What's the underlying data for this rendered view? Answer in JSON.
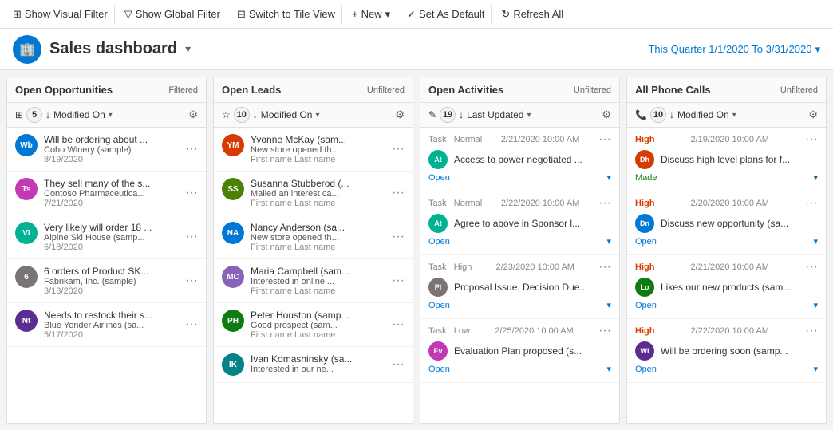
{
  "toolbar": {
    "show_visual_filter": "Show Visual Filter",
    "show_global_filter": "Show Global Filter",
    "switch_tile_view": "Switch to Tile View",
    "new_label": "New",
    "set_as_default": "Set As Default",
    "refresh_all": "Refresh All"
  },
  "header": {
    "title": "Sales dashboard",
    "date_range": "This Quarter 1/1/2020 To 3/31/2020"
  },
  "columns": [
    {
      "id": "open-opportunities",
      "title": "Open Opportunities",
      "status": "Filtered",
      "count": 5,
      "sort_by": "Modified On",
      "items": [
        {
          "initials": "Wb",
          "color": "#0078d4",
          "title": "Will be ordering about ...",
          "company": "Coho Winery (sample)",
          "date": "8/19/2020"
        },
        {
          "initials": "Ts",
          "color": "#c239b3",
          "title": "They sell many of the s...",
          "company": "Contoso Pharmaceutica...",
          "date": "7/21/2020"
        },
        {
          "initials": "VI",
          "color": "#00b294",
          "title": "Very likely will order 18 ...",
          "company": "Alpine Ski House (samp...",
          "date": "6/18/2020"
        },
        {
          "initials": "6",
          "color": "#7a7574",
          "title": "6 orders of Product SK...",
          "company": "Fabrikam, Inc. (sample)",
          "date": "3/18/2020"
        },
        {
          "initials": "Nt",
          "color": "#5c2d91",
          "title": "Needs to restock their s...",
          "company": "Blue Yonder Airlines (sa...",
          "date": "5/17/2020"
        }
      ]
    },
    {
      "id": "open-leads",
      "title": "Open Leads",
      "status": "Unfiltered",
      "count": 10,
      "sort_by": "Modified On",
      "items": [
        {
          "initials": "YM",
          "color": "#d83b01",
          "name": "Yvonne McKay (sam...",
          "note": "New store opened th...",
          "sub": "First name Last name"
        },
        {
          "initials": "SS",
          "color": "#498205",
          "name": "Susanna Stubberod (...",
          "note": "Mailed an interest ca...",
          "sub": "First name Last name"
        },
        {
          "initials": "NA",
          "color": "#0078d4",
          "name": "Nancy Anderson (sa...",
          "note": "New store opened th...",
          "sub": "First name Last name"
        },
        {
          "initials": "MC",
          "color": "#8764b8",
          "name": "Maria Campbell (sam...",
          "note": "Interested in online ...",
          "sub": "First name Last name"
        },
        {
          "initials": "PH",
          "color": "#107c10",
          "name": "Peter Houston (samp...",
          "note": "Good prospect (sam...",
          "sub": "First name Last name"
        },
        {
          "initials": "IK",
          "color": "#038387",
          "name": "Ivan Komashinsky (sa...",
          "note": "Interested in our ne...",
          "sub": ""
        }
      ]
    },
    {
      "id": "open-activities",
      "title": "Open Activities",
      "status": "Unfiltered",
      "count": 19,
      "sort_by": "Last Updated",
      "items": [
        {
          "type": "Task",
          "priority": "Normal",
          "datetime": "2/21/2020 10:00 AM",
          "avatar_color": "#00b294",
          "avatar_initials": "At",
          "title": "Access to power negotiated ...",
          "status": "Open"
        },
        {
          "type": "Task",
          "priority": "Normal",
          "datetime": "2/22/2020 10:00 AM",
          "avatar_color": "#00b294",
          "avatar_initials": "At",
          "title": "Agree to above in Sponsor l...",
          "status": "Open"
        },
        {
          "type": "Task",
          "priority": "High",
          "datetime": "2/23/2020 10:00 AM",
          "avatar_color": "#7a7574",
          "avatar_initials": "Pl",
          "title": "Proposal Issue, Decision Due...",
          "status": "Open"
        },
        {
          "type": "Task",
          "priority": "Low",
          "datetime": "2/25/2020 10:00 AM",
          "avatar_color": "#c239b3",
          "avatar_initials": "Ev",
          "title": "Evaluation Plan proposed (s...",
          "status": "Open"
        }
      ]
    },
    {
      "id": "all-phone-calls",
      "title": "All Phone Calls",
      "status": "Unfiltered",
      "count": 10,
      "sort_by": "Modified On",
      "items": [
        {
          "priority": "High",
          "datetime": "2/19/2020 10:00 AM",
          "avatar_color": "#d83b01",
          "avatar_initials": "Dh",
          "title": "Discuss high level plans for f...",
          "status": "Made"
        },
        {
          "priority": "High",
          "datetime": "2/20/2020 10:00 AM",
          "avatar_color": "#0078d4",
          "avatar_initials": "Dn",
          "title": "Discuss new opportunity (sa...",
          "status": "Open"
        },
        {
          "priority": "High",
          "datetime": "2/21/2020 10:00 AM",
          "avatar_color": "#107c10",
          "avatar_initials": "Lo",
          "title": "Likes our new products (sam...",
          "status": "Open"
        },
        {
          "priority": "High",
          "datetime": "2/22/2020 10:00 AM",
          "avatar_color": "#5c2d91",
          "avatar_initials": "Wi",
          "title": "Will be ordering soon (samp...",
          "status": "Open"
        }
      ]
    }
  ]
}
